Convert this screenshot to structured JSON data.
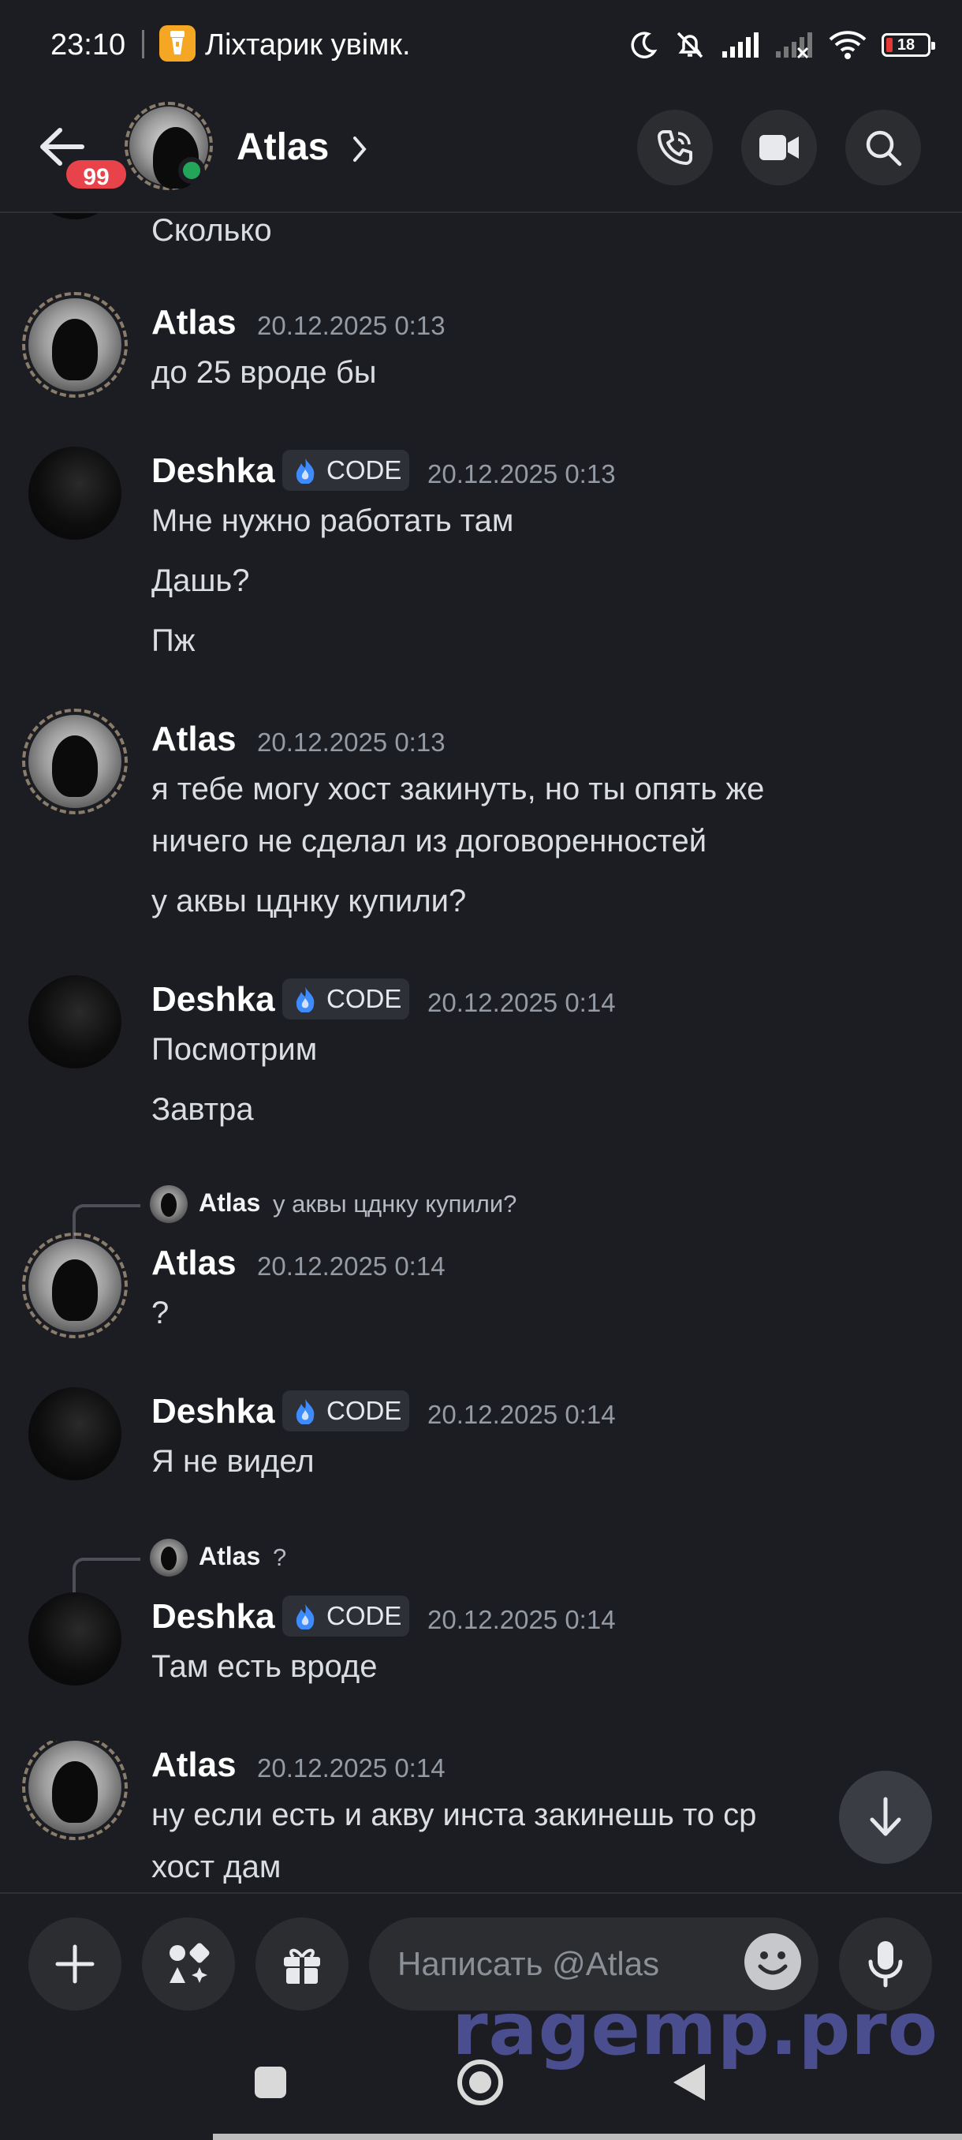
{
  "status_bar": {
    "time": "23:10",
    "flashlight_text": "Ліхтарик увімк.",
    "battery": "18",
    "icons": [
      "moon-icon",
      "bell-off-icon",
      "signal-icon",
      "signal-icon",
      "wifi-icon",
      "battery-icon"
    ]
  },
  "header": {
    "badge": "99",
    "title": "Atlas",
    "buttons": [
      "phone-icon",
      "video-icon",
      "search-icon"
    ]
  },
  "messages": [
    {
      "lines": [
        "Сколько"
      ]
    },
    {
      "author": "Atlas",
      "time": "20.12.2025 0:13",
      "lines": [
        "до 25 вроде бы"
      ]
    },
    {
      "author": "Deshka",
      "tag": "CODE",
      "time": "20.12.2025 0:13",
      "lines": [
        "Мне нужно работать там",
        "Дашь?",
        "Пж"
      ]
    },
    {
      "author": "Atlas",
      "time": "20.12.2025 0:13",
      "lines": [
        "я тебе могу хост закинуть, но ты опять же",
        "ничего не сделал из договоренностей",
        "у аквы цднку купили?"
      ]
    },
    {
      "author": "Deshka",
      "tag": "CODE",
      "time": "20.12.2025 0:14",
      "lines": [
        "Посмотрим",
        "Завтра"
      ]
    },
    {
      "reply": {
        "name": "Atlas",
        "text": "у аквы цднку купили?"
      },
      "author": "Atlas",
      "time": "20.12.2025 0:14",
      "lines": [
        "?"
      ]
    },
    {
      "author": "Deshka",
      "tag": "CODE",
      "time": "20.12.2025 0:14",
      "lines": [
        "Я не видел"
      ]
    },
    {
      "reply": {
        "name": "Atlas",
        "text": "?"
      },
      "author": "Deshka",
      "tag": "CODE",
      "time": "20.12.2025 0:14",
      "lines": [
        "Там есть вроде"
      ]
    },
    {
      "author": "Atlas",
      "time": "20.12.2025 0:14",
      "lines": [
        "ну если есть и акву инста закинешь то ср",
        "хост дам"
      ]
    }
  ],
  "composer": {
    "placeholder": "Написать @Atlas"
  },
  "watermark": "ragemp.pro"
}
